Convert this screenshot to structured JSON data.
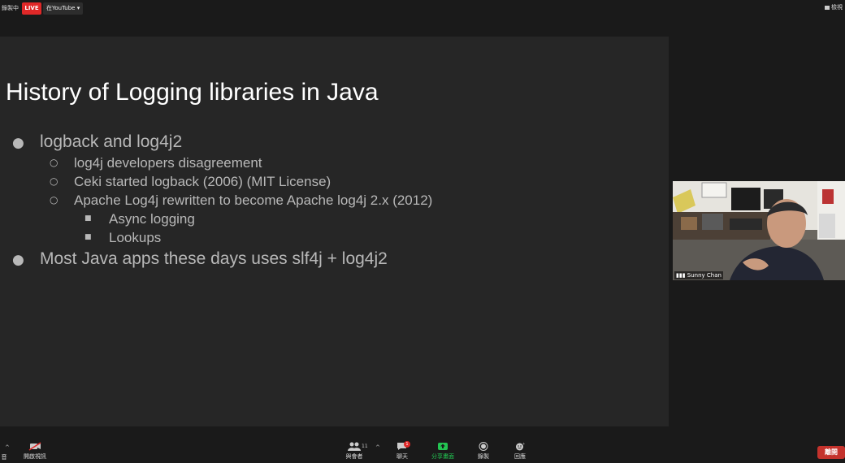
{
  "topbar": {
    "recording_label": "錄製中",
    "live_label": "LIVE",
    "youtube_button": "在YouTube ▾",
    "view_label": "檢視"
  },
  "slide": {
    "title": "History of Logging libraries in Java",
    "bullets": [
      {
        "level": 1,
        "text": "logback and log4j2"
      },
      {
        "level": 2,
        "text": "log4j developers disagreement"
      },
      {
        "level": 2,
        "text": "Ceki started logback (2006) (MIT License)"
      },
      {
        "level": 2,
        "text": "Apache Log4j rewritten to become Apache log4j 2.x  (2012)"
      },
      {
        "level": 3,
        "text": "Async logging"
      },
      {
        "level": 3,
        "text": "Lookups"
      },
      {
        "level": 1,
        "text": "Most Java apps these days uses slf4j + log4j2"
      }
    ]
  },
  "video": {
    "participant_name": "Sunny Chan"
  },
  "toolbar": {
    "audio_label": "音",
    "video_label": "開啟視訊",
    "participants_label": "與會者",
    "participants_count": "11",
    "chat_label": "聊天",
    "chat_badge": "1",
    "share_label": "分享畫面",
    "record_label": "錄製",
    "reactions_label": "回應",
    "end_label": "離開"
  },
  "colors": {
    "live": "#e02828",
    "share": "#23c552",
    "end": "#c4322c"
  }
}
